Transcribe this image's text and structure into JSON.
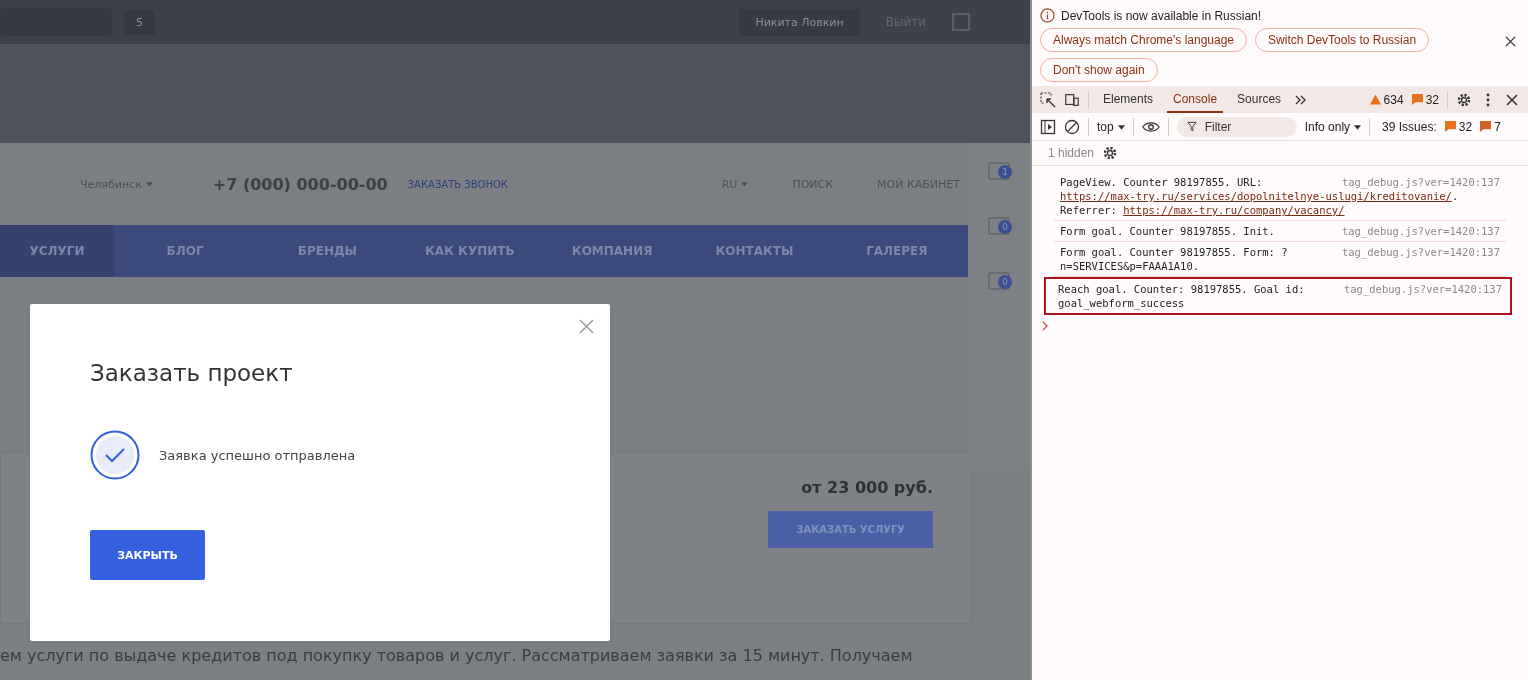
{
  "site": {
    "admin_bar": {
      "notifications": "5",
      "user": "Никита Ловкин",
      "logout": "Выйти"
    },
    "header": {
      "city": "Челябинск",
      "phone": "+7 (000) 000-00-00",
      "callback": "ЗАКАЗАТЬ ЗВОНОК",
      "language": "RU",
      "search": "ПОИСК",
      "account": "МОЙ КАБИНЕТ"
    },
    "nav": [
      {
        "label": "УСЛУГИ",
        "selected": true
      },
      {
        "label": "БЛОГ",
        "selected": false
      },
      {
        "label": "БРЕНДЫ",
        "selected": false
      },
      {
        "label": "КАК КУПИТЬ",
        "selected": false
      },
      {
        "label": "КОМПАНИЯ",
        "selected": false
      },
      {
        "label": "КОНТАКТЫ",
        "selected": false
      },
      {
        "label": "ГАЛЕРЕЯ",
        "selected": false
      }
    ],
    "side_badges": [
      "1",
      "0",
      "0"
    ],
    "service": {
      "price": "от 23 000 руб.",
      "button": "ЗАКАЗАТЬ УСЛУГУ"
    },
    "paragraph": "ем услуги по выдаче кредитов под покупку товаров и услуг. Рассматриваем заявки за 15 минут. Получаем"
  },
  "modal": {
    "title": "Заказать проект",
    "message": "Заявка успешно отправлена",
    "button": "ЗАКРЫТЬ"
  },
  "devtools": {
    "infobar": {
      "message": "DevTools is now available in Russian!",
      "buttons": [
        "Always match Chrome's language",
        "Switch DevTools to Russian",
        "Don't show again"
      ]
    },
    "tabs": [
      {
        "label": "Elements",
        "selected": false
      },
      {
        "label": "Console",
        "selected": true
      },
      {
        "label": "Sources",
        "selected": false
      }
    ],
    "warnings": "634",
    "errors": "32",
    "console_toolbar": {
      "context": "top",
      "filter_placeholder": "Filter",
      "levels": "Info only",
      "issues": "39 Issues:",
      "issue_errors": "32",
      "issue_infos": "7"
    },
    "hidden": "1 hidden",
    "messages": [
      {
        "highlighted": false,
        "source": "tag_debug.js?ver=1420:137",
        "lines": [
          [
            {
              "kind": "text",
              "text": "PageView. Counter 98197855. URL:"
            }
          ],
          [
            {
              "kind": "link",
              "text": "https://max-try.ru/services/dopolnitelnye-uslugi/kreditovanie/"
            },
            {
              "kind": "text",
              "text": "."
            }
          ],
          [
            {
              "kind": "text",
              "text": "Referrer: "
            },
            {
              "kind": "link",
              "text": "https://max-try.ru/company/vacancy/"
            }
          ]
        ]
      },
      {
        "highlighted": false,
        "source": "tag_debug.js?ver=1420:137",
        "lines": [
          [
            {
              "kind": "text",
              "text": "Form goal. Counter 98197855. Init."
            }
          ]
        ]
      },
      {
        "highlighted": false,
        "source": "tag_debug.js?ver=1420:137",
        "lines": [
          [
            {
              "kind": "text",
              "text": "Form goal. Counter 98197855. Form: ?"
            }
          ],
          [
            {
              "kind": "text",
              "text": "n=SERVICES&p=FAAA1A10."
            }
          ]
        ]
      },
      {
        "highlighted": true,
        "source": "tag_debug.js?ver=1420:137",
        "lines": [
          [
            {
              "kind": "text",
              "text": "Reach goal. Counter: 98197855. Goal id:"
            }
          ],
          [
            {
              "kind": "text",
              "text": "goal_webform_success"
            }
          ]
        ]
      }
    ]
  }
}
